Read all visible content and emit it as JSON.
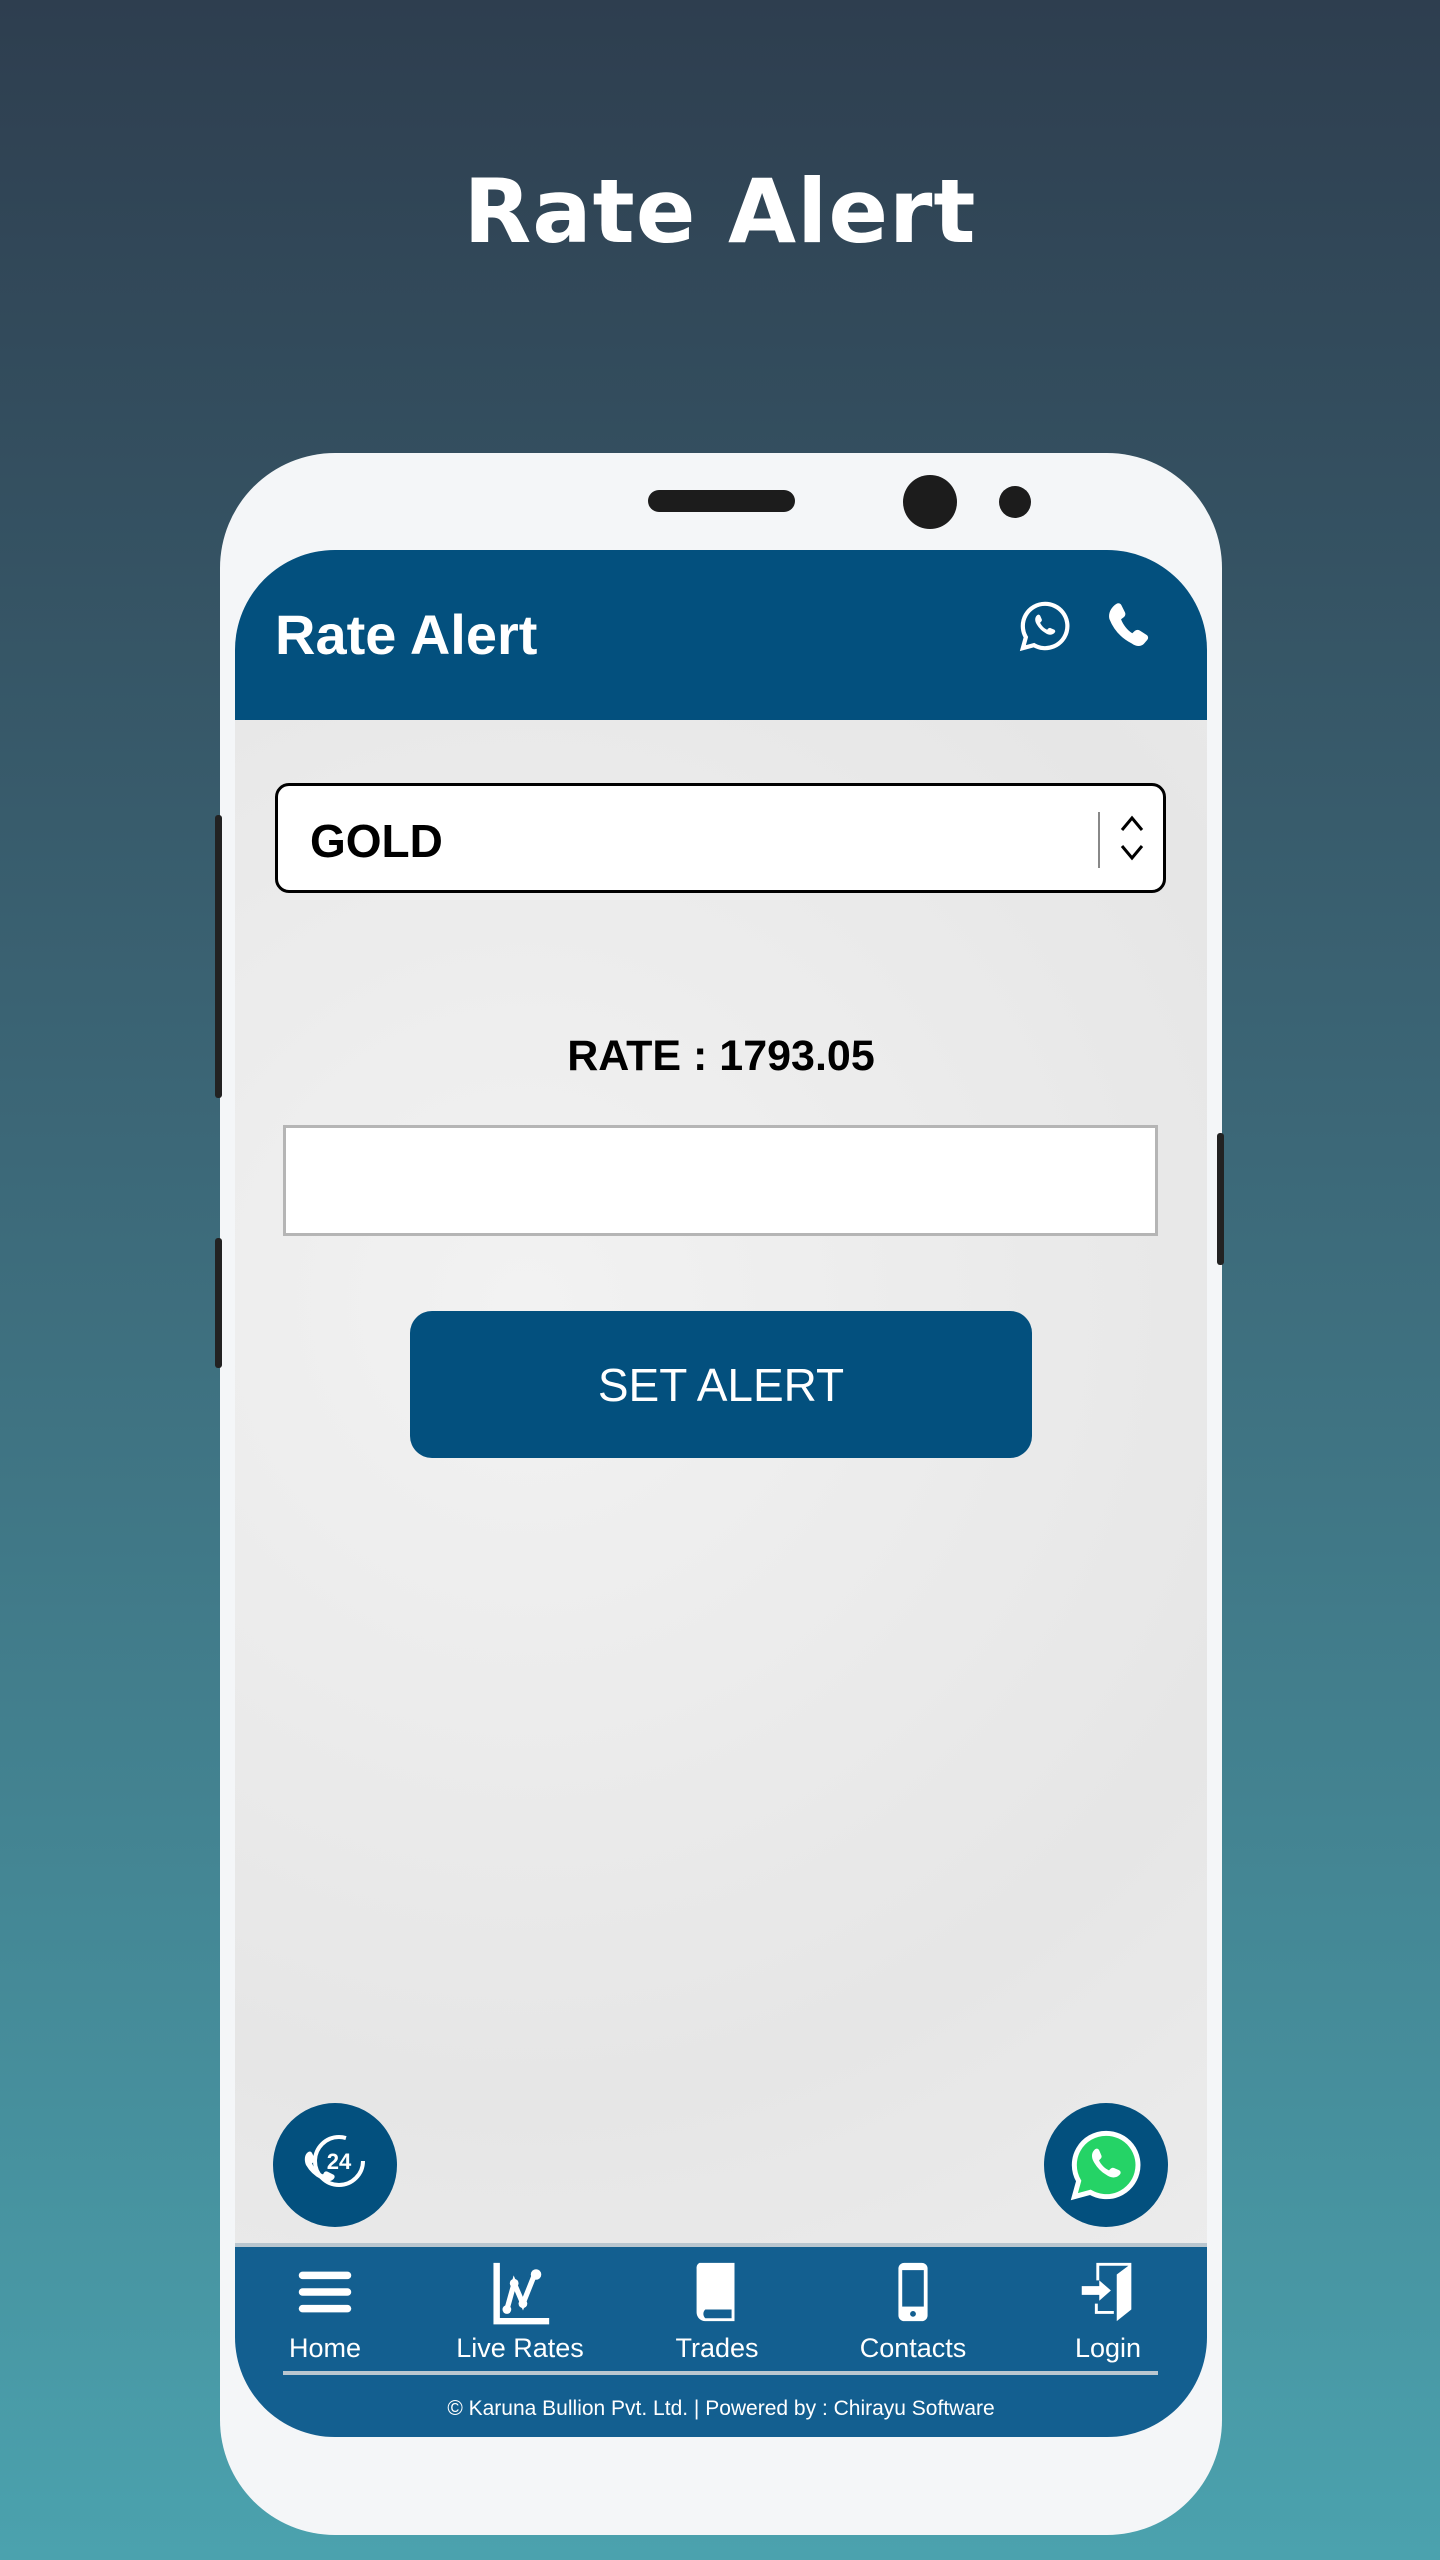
{
  "promo_title": "Rate Alert",
  "header": {
    "title": "Rate Alert",
    "icons": [
      "whatsapp-icon",
      "phone-icon"
    ]
  },
  "form": {
    "commodity_selected": "GOLD",
    "rate_label": "RATE : 1793.05",
    "rate_input_value": "",
    "set_alert_label": "SET ALERT"
  },
  "floating": {
    "left": "24h-support-icon",
    "right": "whatsapp-icon"
  },
  "nav": {
    "items": [
      {
        "label": "Home",
        "icon": "menu-icon"
      },
      {
        "label": "Live Rates",
        "icon": "chart-icon"
      },
      {
        "label": "Trades",
        "icon": "book-icon"
      },
      {
        "label": "Contacts",
        "icon": "mobile-icon"
      },
      {
        "label": "Login",
        "icon": "login-icon"
      }
    ]
  },
  "footer": "© Karuna Bullion Pvt. Ltd. |  Powered by : Chirayu Software",
  "colors": {
    "primary": "#03507e",
    "nav": "#135f90",
    "whatsapp": "#25d366"
  }
}
